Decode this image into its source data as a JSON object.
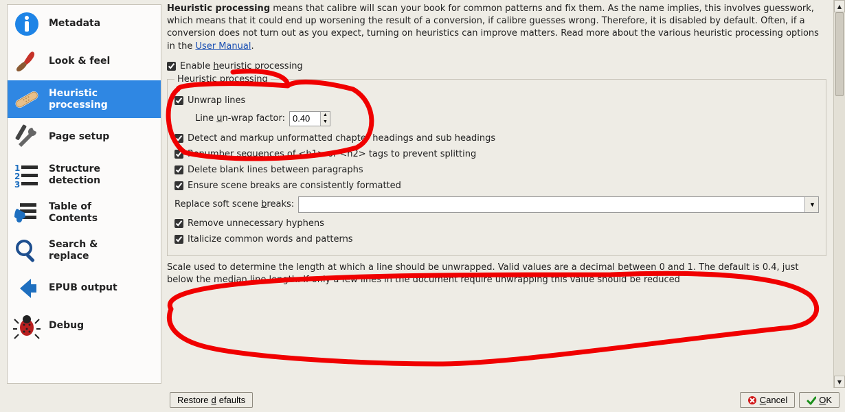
{
  "sidebar": {
    "items": [
      {
        "label": "Metadata"
      },
      {
        "label": "Look & feel"
      },
      {
        "label": "Heuristic",
        "label2": "processing"
      },
      {
        "label": "Page setup"
      },
      {
        "label": "Structure",
        "label2": "detection"
      },
      {
        "label": "Table of",
        "label2": "Contents"
      },
      {
        "label": "Search &",
        "label2": "replace"
      },
      {
        "label": "EPUB output"
      },
      {
        "label": "Debug"
      }
    ]
  },
  "intro": {
    "bold": "Heuristic processing",
    "text": " means that calibre will scan your book for common patterns and fix them. As the name implies, this involves guesswork, which means that it could end up worsening the result of a conversion, if calibre guesses wrong. Therefore, it is disabled by default. Often, if a conversion does not turn out as you expect, turning on heuristics can improve matters. Read more about the various heuristic processing options in the ",
    "link_label": "User Manual"
  },
  "enable": {
    "pre": "Enable ",
    "u": "h",
    "post": "euristic processing",
    "checked": true
  },
  "group_legend": "Heuristic processing",
  "unwrap": {
    "label": "Unwrap lines",
    "checked": true
  },
  "factor": {
    "pre": "Line ",
    "u": "u",
    "post": "n-wrap factor:",
    "value": "0.40"
  },
  "opts": {
    "detect": {
      "label": "Detect and markup unformatted chapter headings and sub headings",
      "checked": true
    },
    "renumber": {
      "label": "Renumber sequences of <h1> or <h2> tags to prevent splitting",
      "checked": true
    },
    "delete_blank": {
      "label": "Delete blank lines between paragraphs",
      "checked": true
    },
    "scene": {
      "label": "Ensure scene breaks are consistently formatted",
      "checked": true
    },
    "replace_label_pre": "Replace soft scene ",
    "replace_label_u": "b",
    "replace_label_post": "reaks:",
    "replace_value": "",
    "hyphens": {
      "label": "Remove unnecessary hyphens",
      "checked": true
    },
    "italic": {
      "label": "Italicize common words and patterns",
      "checked": true
    }
  },
  "help_text": "Scale used to determine the length at which a line should be unwrapped. Valid values are a decimal between 0 and 1. The default is 0.4, just below the median line length.  If only a few lines in the document require unwrapping this value should be reduced",
  "buttons": {
    "restore_pre": "Restore ",
    "restore_u": "d",
    "restore_post": "efaults",
    "cancel_u": "C",
    "cancel_post": "ancel",
    "ok_u": "O",
    "ok_post": "K"
  }
}
